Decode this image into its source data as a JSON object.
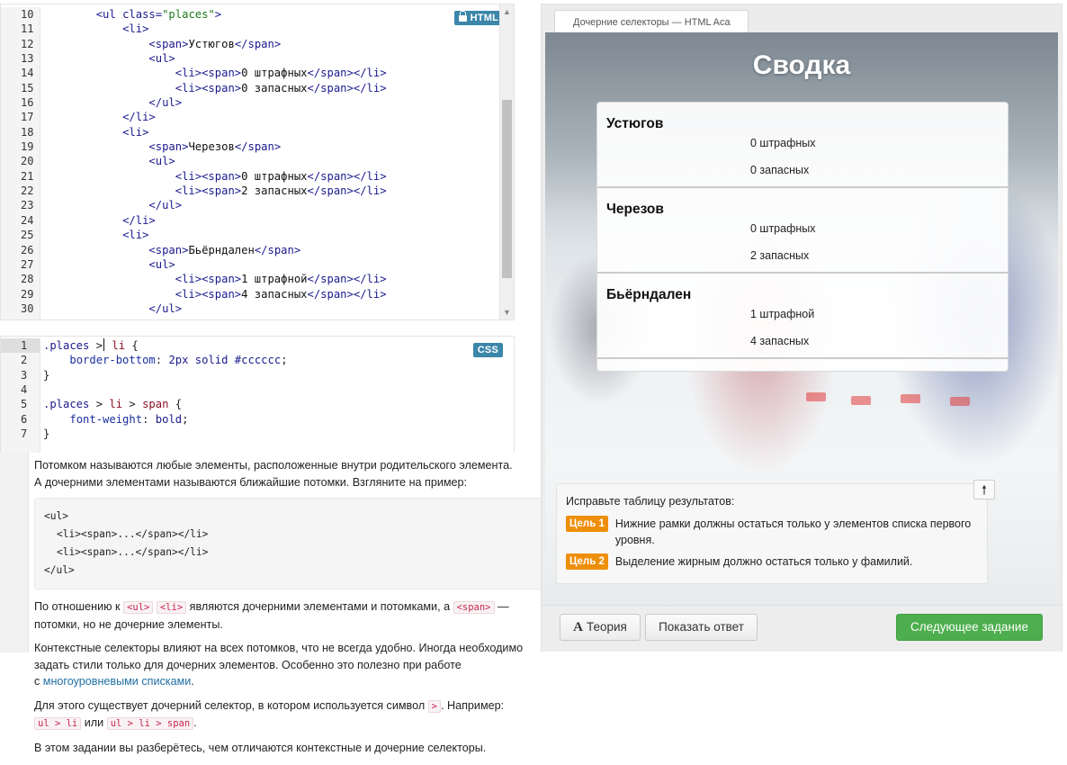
{
  "html_editor": {
    "badge": "HTML",
    "line_numbers": [
      "10",
      "11",
      "12",
      "13",
      "14",
      "15",
      "16",
      "17",
      "18",
      "19",
      "20",
      "21",
      "22",
      "23",
      "24",
      "25",
      "26",
      "27",
      "28",
      "29",
      "30"
    ],
    "lines": [
      {
        "indent": "        ",
        "parts": [
          [
            "tag",
            "<ul "
          ],
          [
            "attr",
            "class="
          ],
          [
            "str",
            "\"places\""
          ],
          [
            "tag",
            ">"
          ]
        ]
      },
      {
        "indent": "            ",
        "parts": [
          [
            "tag",
            "<li>"
          ]
        ]
      },
      {
        "indent": "                ",
        "parts": [
          [
            "tag",
            "<span>"
          ],
          [
            "text",
            "Устюгов"
          ],
          [
            "tag",
            "</span>"
          ]
        ]
      },
      {
        "indent": "                ",
        "parts": [
          [
            "tag",
            "<ul>"
          ]
        ]
      },
      {
        "indent": "                    ",
        "parts": [
          [
            "tag",
            "<li><span>"
          ],
          [
            "text",
            "0 штрафных"
          ],
          [
            "tag",
            "</span></li>"
          ]
        ]
      },
      {
        "indent": "                    ",
        "parts": [
          [
            "tag",
            "<li><span>"
          ],
          [
            "text",
            "0 запасных"
          ],
          [
            "tag",
            "</span></li>"
          ]
        ]
      },
      {
        "indent": "                ",
        "parts": [
          [
            "tag",
            "</ul>"
          ]
        ]
      },
      {
        "indent": "            ",
        "parts": [
          [
            "tag",
            "</li>"
          ]
        ]
      },
      {
        "indent": "            ",
        "parts": [
          [
            "tag",
            "<li>"
          ]
        ]
      },
      {
        "indent": "                ",
        "parts": [
          [
            "tag",
            "<span>"
          ],
          [
            "text",
            "Черезов"
          ],
          [
            "tag",
            "</span>"
          ]
        ]
      },
      {
        "indent": "                ",
        "parts": [
          [
            "tag",
            "<ul>"
          ]
        ]
      },
      {
        "indent": "                    ",
        "parts": [
          [
            "tag",
            "<li><span>"
          ],
          [
            "text",
            "0 штрафных"
          ],
          [
            "tag",
            "</span></li>"
          ]
        ]
      },
      {
        "indent": "                    ",
        "parts": [
          [
            "tag",
            "<li><span>"
          ],
          [
            "text",
            "2 запасных"
          ],
          [
            "tag",
            "</span></li>"
          ]
        ]
      },
      {
        "indent": "                ",
        "parts": [
          [
            "tag",
            "</ul>"
          ]
        ]
      },
      {
        "indent": "            ",
        "parts": [
          [
            "tag",
            "</li>"
          ]
        ]
      },
      {
        "indent": "            ",
        "parts": [
          [
            "tag",
            "<li>"
          ]
        ]
      },
      {
        "indent": "                ",
        "parts": [
          [
            "tag",
            "<span>"
          ],
          [
            "text",
            "Бьёрндален"
          ],
          [
            "tag",
            "</span>"
          ]
        ]
      },
      {
        "indent": "                ",
        "parts": [
          [
            "tag",
            "<ul>"
          ]
        ]
      },
      {
        "indent": "                    ",
        "parts": [
          [
            "tag",
            "<li><span>"
          ],
          [
            "text",
            "1 штрафной"
          ],
          [
            "tag",
            "</span></li>"
          ]
        ]
      },
      {
        "indent": "                    ",
        "parts": [
          [
            "tag",
            "<li><span>"
          ],
          [
            "text",
            "4 запасных"
          ],
          [
            "tag",
            "</span></li>"
          ]
        ]
      },
      {
        "indent": "                ",
        "parts": [
          [
            "tag",
            "</ul>"
          ]
        ]
      }
    ]
  },
  "css_editor": {
    "badge": "CSS",
    "line_numbers": [
      "1",
      "2",
      "3",
      "4",
      "5",
      "6",
      "7"
    ],
    "lines": [
      {
        "indent": "",
        "parts": [
          [
            "sel",
            ".places "
          ],
          [
            "punc",
            ">"
          ],
          [
            "caret",
            ""
          ],
          [
            "punc",
            " "
          ],
          [
            "el",
            "li"
          ],
          [
            "punc",
            " {"
          ]
        ]
      },
      {
        "indent": "    ",
        "parts": [
          [
            "prop",
            "border-bottom"
          ],
          [
            "punc",
            ": "
          ],
          [
            "val",
            "2px solid #cccccc"
          ],
          [
            "punc",
            ";"
          ]
        ]
      },
      {
        "indent": "",
        "parts": [
          [
            "punc",
            "}"
          ]
        ]
      },
      {
        "indent": "",
        "parts": []
      },
      {
        "indent": "",
        "parts": [
          [
            "sel",
            ".places "
          ],
          [
            "punc",
            "> "
          ],
          [
            "el",
            "li"
          ],
          [
            "punc",
            " > "
          ],
          [
            "el",
            "span"
          ],
          [
            "punc",
            " {"
          ]
        ]
      },
      {
        "indent": "    ",
        "parts": [
          [
            "prop",
            "font-weight"
          ],
          [
            "punc",
            ": "
          ],
          [
            "val",
            "bold"
          ],
          [
            "punc",
            ";"
          ]
        ]
      },
      {
        "indent": "",
        "parts": [
          [
            "punc",
            "}"
          ]
        ]
      }
    ]
  },
  "theory": {
    "p1_line1": "Потомком называются любые элементы, расположенные внутри родительского элемента.",
    "p1_line2": "А дочерними элементами называются ближайшие потомки. Взгляните на пример:",
    "example": [
      "<ul>",
      "<li><span>...</span></li>",
      "<li><span>...</span></li>",
      "</ul>"
    ],
    "p2_before": "По отношению к ",
    "p2_code1": "<ul>",
    "p2_code2": "<li>",
    "p2_mid": " являются дочерними элементами и потомками, а ",
    "p2_code3": "<span>",
    "p2_after": " —",
    "p2_line2": "потомки, но не дочерние элементы.",
    "p3_line1": "Контекстные селекторы влияют на всех потомков, что не всегда удобно. Иногда необходимо",
    "p3_line2": "задать стили только для дочерних элементов. Особенно это полезно при работе",
    "p3_line3_before": "с ",
    "p3_link": "многоуровневыми списками",
    "p3_line3_after": ".",
    "p4_before": "Для этого существует дочерний селектор, в котором используется символ ",
    "p4_code": ">",
    "p4_after": ". Например:",
    "p4_code2": "ul > li",
    "p4_or": " или ",
    "p4_code3": "ul > li > span",
    "p4_end": ".",
    "p5": "В этом задании вы разберётесь, чем отличаются контекстные и дочерние селекторы."
  },
  "preview": {
    "tab_title": "Дочерние селекторы — HTML Aca",
    "summary_title": "Сводка",
    "teams": [
      {
        "name": "Устюгов",
        "stats": [
          "0 штрафных",
          "0 запасных"
        ]
      },
      {
        "name": "Черезов",
        "stats": [
          "0 штрафных",
          "2 запасных"
        ]
      },
      {
        "name": "Бьёрндален",
        "stats": [
          "1 штрафной",
          "4 запасных"
        ]
      }
    ],
    "tasks_intro": "Исправьте таблицу результатов:",
    "goals": [
      {
        "label": "Цель 1",
        "text": "Нижние рамки должны остаться только у элементов списка первого уровня."
      },
      {
        "label": "Цель 2",
        "text": "Выделение жирным должно остаться только у фамилий."
      }
    ],
    "up_arrow": "🠕"
  },
  "buttons": {
    "theory_glyph": "A",
    "theory_label": "Теория",
    "answer_label": "Показать ответ",
    "next_label": "Следующее задание"
  },
  "colors": {
    "badge": "#3b86a9",
    "goal_label": "#ee8f0c",
    "next_button": "#4cae4c",
    "inline_code": "#c7254e",
    "link": "#1f6fa5"
  }
}
